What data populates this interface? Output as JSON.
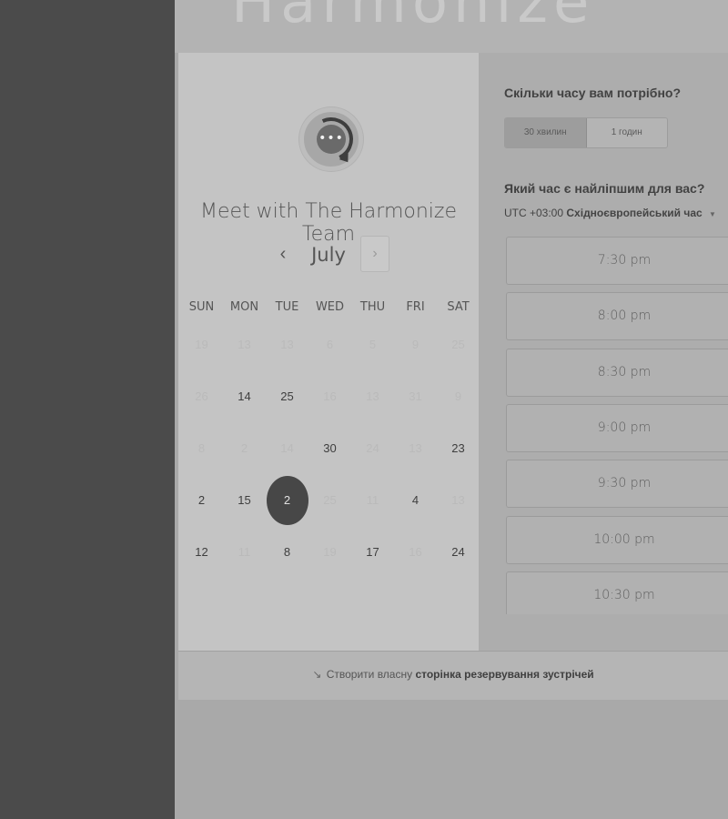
{
  "brand": {
    "logo_text": "Harmonize"
  },
  "calendar": {
    "title": "Meet with The Harmonize Team",
    "month": "July",
    "prev_icon": "‹",
    "next_icon": "›",
    "weekdays": [
      "SUN",
      "MON",
      "TUE",
      "WED",
      "THU",
      "FRI",
      "SAT"
    ],
    "weeks": [
      [
        {
          "d": "19",
          "on": false
        },
        {
          "d": "13",
          "on": false
        },
        {
          "d": "13",
          "on": false
        },
        {
          "d": "6",
          "on": false
        },
        {
          "d": "5",
          "on": false
        },
        {
          "d": "9",
          "on": false
        },
        {
          "d": "25",
          "on": false
        }
      ],
      [
        {
          "d": "26",
          "on": false
        },
        {
          "d": "14",
          "on": true
        },
        {
          "d": "25",
          "on": true
        },
        {
          "d": "16",
          "on": false
        },
        {
          "d": "13",
          "on": false
        },
        {
          "d": "31",
          "on": false
        },
        {
          "d": "9",
          "on": false
        }
      ],
      [
        {
          "d": "8",
          "on": false
        },
        {
          "d": "2",
          "on": false
        },
        {
          "d": "14",
          "on": false
        },
        {
          "d": "30",
          "on": true
        },
        {
          "d": "24",
          "on": false
        },
        {
          "d": "13",
          "on": false
        },
        {
          "d": "23",
          "on": true
        }
      ],
      [
        {
          "d": "2",
          "on": true
        },
        {
          "d": "15",
          "on": true
        },
        {
          "d": "2",
          "on": true,
          "selected": true
        },
        {
          "d": "25",
          "on": false
        },
        {
          "d": "11",
          "on": false
        },
        {
          "d": "4",
          "on": true
        },
        {
          "d": "13",
          "on": false
        }
      ],
      [
        {
          "d": "12",
          "on": true
        },
        {
          "d": "11",
          "on": false
        },
        {
          "d": "8",
          "on": true
        },
        {
          "d": "19",
          "on": false
        },
        {
          "d": "17",
          "on": true
        },
        {
          "d": "16",
          "on": false
        },
        {
          "d": "24",
          "on": true
        }
      ]
    ]
  },
  "scheduling": {
    "duration_question": "Скільки часу вам потрібно?",
    "durations": [
      "30 хвилин",
      "1 годин"
    ],
    "time_question": "Який час є найліпшим для вас?",
    "timezone_offset": "UTC +03:00",
    "timezone_name": "Східноєвропейський час",
    "slots": [
      "7:30 pm",
      "8:00 pm",
      "8:30 pm",
      "9:00 pm",
      "9:30 pm",
      "10:00 pm",
      "10:30 pm"
    ]
  },
  "footer": {
    "prefix": "Створити власну",
    "link": "сторінка резервування зустрічей"
  }
}
